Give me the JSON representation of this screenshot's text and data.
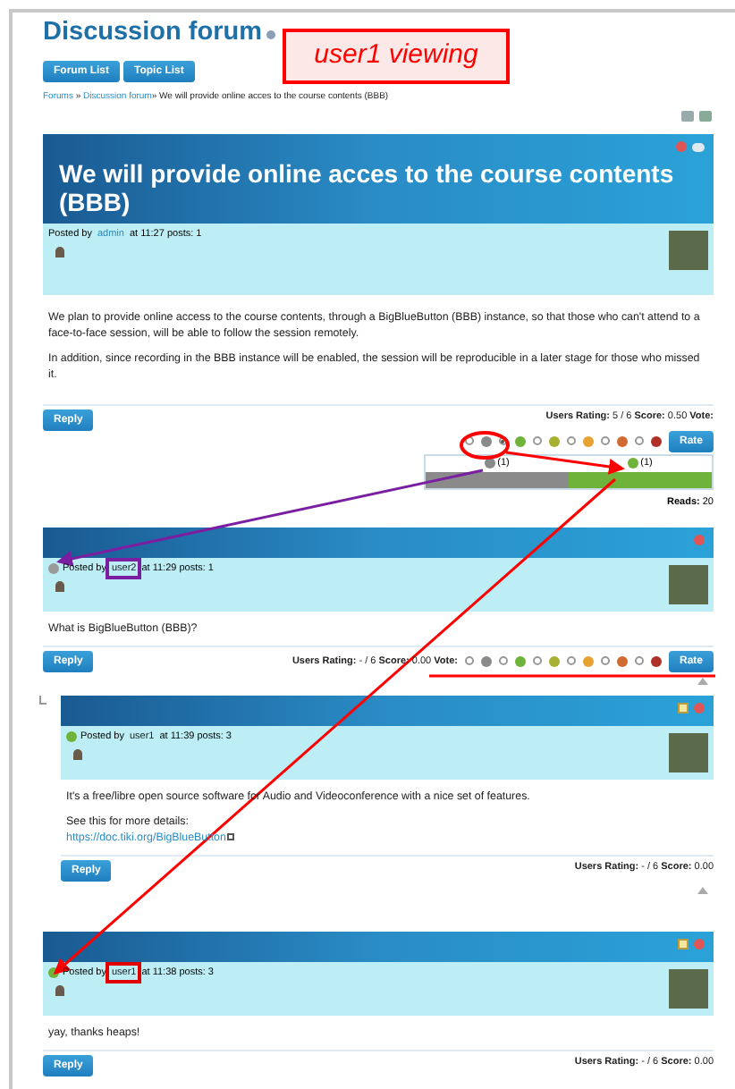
{
  "page": {
    "title": "Discussion forum",
    "buttons": [
      "Forum List",
      "Topic List"
    ],
    "breadcrumb": [
      {
        "text": "Forums",
        "link": true
      },
      {
        "text": " » ",
        "link": false
      },
      {
        "text": "Discussion forum",
        "link": true
      },
      {
        "text": "» We will provide online acces to the course contents (BBB)",
        "link": false
      }
    ]
  },
  "annotation": {
    "label": "user1 viewing"
  },
  "topic": {
    "title": "We will provide online acces to the course contents (BBB)",
    "watchable": true,
    "editable": false,
    "posted_by": "Posted by",
    "author": "admin",
    "meta": "at 11:27 posts: 1",
    "body": [
      {
        "text": "We plan to provide online access to the course contents, through a BigBlueButton (BBB) instance, so that those who can't attend to a face-to-face session, will be able to follow the session remotely."
      },
      {
        "text": "In addition, since recording in the BBB instance will be enabled, the session will be reproducible in a later stage for those who missed it."
      }
    ],
    "reply": "Reply",
    "rating": "**Users Rating:** 5 / 6 **Score:** 0.50 **Vote:**",
    "rate": "Rate",
    "vote_options": [
      {
        "color": "#8a8a8a",
        "selected": false
      },
      {
        "color": "#6fb33a",
        "selected": true
      },
      {
        "color": "#a8b030",
        "selected": false
      },
      {
        "color": "#e8a030",
        "selected": false
      },
      {
        "color": "#d06a30",
        "selected": false
      },
      {
        "color": "#b03028",
        "selected": false
      }
    ],
    "results": [
      {
        "color": "#8a8a8a",
        "count": "(1)",
        "level": 1
      },
      {
        "color": "#6fb33a",
        "count": "(1)",
        "level": 1
      }
    ],
    "reads": "**Reads:** 20"
  },
  "replies": [
    {
      "online": false,
      "watchable": false,
      "editable": false,
      "posted_by": "Posted by",
      "author": "user2",
      "color": "#7b1fa2",
      "meta": "at 11:29 posts: 1",
      "top_link": true,
      "body": [
        {
          "text": "What is BigBlueButton (BBB)?"
        }
      ],
      "reply": "Reply",
      "rating": "**Users Rating:** - / 6 **Score:** 0.00 **Vote:**",
      "rate": "Rate",
      "vote_options": [
        {
          "color": "#8a8a8a",
          "selected": false
        },
        {
          "color": "#6fb33a",
          "selected": false
        },
        {
          "color": "#a8b030",
          "selected": false
        },
        {
          "color": "#e8a030",
          "selected": false
        },
        {
          "color": "#d06a30",
          "selected": false
        },
        {
          "color": "#b03028",
          "selected": false
        }
      ],
      "children": [
        {
          "online": true,
          "watchable": false,
          "editable": true,
          "posted_by": "Posted by",
          "author": "user1",
          "meta": "at 11:39 posts: 3",
          "top_link": true,
          "body": [
            {
              "text": "It's a free/libre open source software for Audio and Videoconference with a nice set of features."
            },
            {
              "text": "See this for more details:",
              "link": "https://doc.tiki.org/BigBlueButton"
            }
          ],
          "reply": "Reply",
          "rating": "**Users Rating:** - / 6 **Score:** 0.00"
        }
      ]
    },
    {
      "online": true,
      "watchable": false,
      "editable": true,
      "posted_by": "Posted by",
      "author": "user1",
      "color": "#e00000",
      "meta": "at 11:38 posts: 3",
      "body": [
        {
          "text": "yay, thanks heaps!"
        }
      ],
      "reply": "Reply",
      "rating": "**Users Rating:** - / 6 **Score:** 0.00"
    }
  ]
}
